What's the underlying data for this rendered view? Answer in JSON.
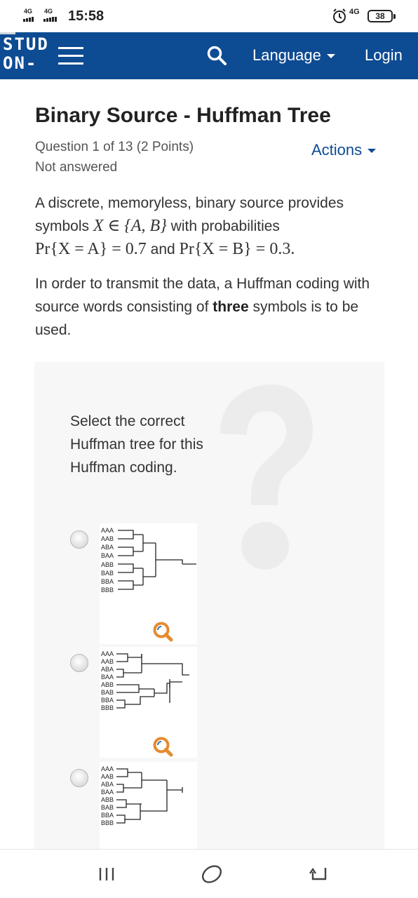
{
  "status_bar": {
    "signal_1": "4G",
    "signal_2": "4G",
    "time": "15:58",
    "network": "4G",
    "battery": "38"
  },
  "header": {
    "logo_line1": "STUD",
    "logo_line2": "ON-",
    "language_label": "Language",
    "login_label": "Login",
    "brand_color": "#0d4b93"
  },
  "question": {
    "title": "Binary Source - Huffman Tree",
    "number": "Question 1 of 13 (2 Points)",
    "status": "Not answered",
    "actions_label": "Actions",
    "p1_text_a": "A discrete, memoryless, binary source provides symbols",
    "p1_math_a": "X ∈ {A, B}",
    "p1_text_b": "with probabilities",
    "p1_math_b": "Pr{X = A} = 0.7",
    "p1_text_c": "and",
    "p1_math_c": "Pr{X = B} = 0.3.",
    "p2_text_a": "In order to transmit the data, a Huffman coding with source words consisting of",
    "p2_bold": "three",
    "p2_text_b": "symbols is to be used."
  },
  "card": {
    "prompt": "Select the correct Huffman tree for this Huffman coding.",
    "leaf_labels": [
      "AAA",
      "AAB",
      "ABA",
      "BAA",
      "ABB",
      "BAB",
      "BBA",
      "BBB"
    ]
  },
  "icons": {
    "zoom": "magnifier-icon",
    "nav_menu": "recent-apps-icon",
    "nav_home": "home-icon",
    "nav_back": "back-icon"
  }
}
